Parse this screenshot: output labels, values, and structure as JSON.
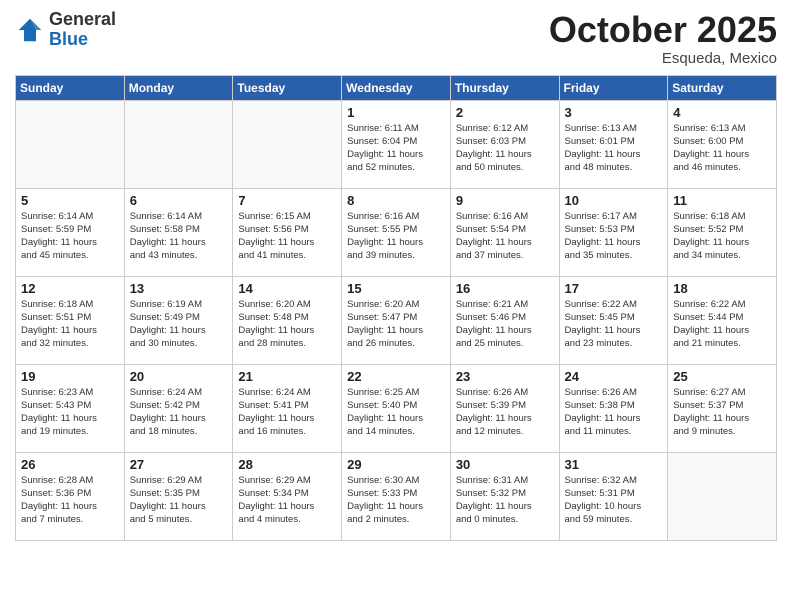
{
  "logo": {
    "general": "General",
    "blue": "Blue"
  },
  "title": "October 2025",
  "location": "Esqueda, Mexico",
  "days_header": [
    "Sunday",
    "Monday",
    "Tuesday",
    "Wednesday",
    "Thursday",
    "Friday",
    "Saturday"
  ],
  "weeks": [
    [
      {
        "day": "",
        "info": ""
      },
      {
        "day": "",
        "info": ""
      },
      {
        "day": "",
        "info": ""
      },
      {
        "day": "1",
        "info": "Sunrise: 6:11 AM\nSunset: 6:04 PM\nDaylight: 11 hours\nand 52 minutes."
      },
      {
        "day": "2",
        "info": "Sunrise: 6:12 AM\nSunset: 6:03 PM\nDaylight: 11 hours\nand 50 minutes."
      },
      {
        "day": "3",
        "info": "Sunrise: 6:13 AM\nSunset: 6:01 PM\nDaylight: 11 hours\nand 48 minutes."
      },
      {
        "day": "4",
        "info": "Sunrise: 6:13 AM\nSunset: 6:00 PM\nDaylight: 11 hours\nand 46 minutes."
      }
    ],
    [
      {
        "day": "5",
        "info": "Sunrise: 6:14 AM\nSunset: 5:59 PM\nDaylight: 11 hours\nand 45 minutes."
      },
      {
        "day": "6",
        "info": "Sunrise: 6:14 AM\nSunset: 5:58 PM\nDaylight: 11 hours\nand 43 minutes."
      },
      {
        "day": "7",
        "info": "Sunrise: 6:15 AM\nSunset: 5:56 PM\nDaylight: 11 hours\nand 41 minutes."
      },
      {
        "day": "8",
        "info": "Sunrise: 6:16 AM\nSunset: 5:55 PM\nDaylight: 11 hours\nand 39 minutes."
      },
      {
        "day": "9",
        "info": "Sunrise: 6:16 AM\nSunset: 5:54 PM\nDaylight: 11 hours\nand 37 minutes."
      },
      {
        "day": "10",
        "info": "Sunrise: 6:17 AM\nSunset: 5:53 PM\nDaylight: 11 hours\nand 35 minutes."
      },
      {
        "day": "11",
        "info": "Sunrise: 6:18 AM\nSunset: 5:52 PM\nDaylight: 11 hours\nand 34 minutes."
      }
    ],
    [
      {
        "day": "12",
        "info": "Sunrise: 6:18 AM\nSunset: 5:51 PM\nDaylight: 11 hours\nand 32 minutes."
      },
      {
        "day": "13",
        "info": "Sunrise: 6:19 AM\nSunset: 5:49 PM\nDaylight: 11 hours\nand 30 minutes."
      },
      {
        "day": "14",
        "info": "Sunrise: 6:20 AM\nSunset: 5:48 PM\nDaylight: 11 hours\nand 28 minutes."
      },
      {
        "day": "15",
        "info": "Sunrise: 6:20 AM\nSunset: 5:47 PM\nDaylight: 11 hours\nand 26 minutes."
      },
      {
        "day": "16",
        "info": "Sunrise: 6:21 AM\nSunset: 5:46 PM\nDaylight: 11 hours\nand 25 minutes."
      },
      {
        "day": "17",
        "info": "Sunrise: 6:22 AM\nSunset: 5:45 PM\nDaylight: 11 hours\nand 23 minutes."
      },
      {
        "day": "18",
        "info": "Sunrise: 6:22 AM\nSunset: 5:44 PM\nDaylight: 11 hours\nand 21 minutes."
      }
    ],
    [
      {
        "day": "19",
        "info": "Sunrise: 6:23 AM\nSunset: 5:43 PM\nDaylight: 11 hours\nand 19 minutes."
      },
      {
        "day": "20",
        "info": "Sunrise: 6:24 AM\nSunset: 5:42 PM\nDaylight: 11 hours\nand 18 minutes."
      },
      {
        "day": "21",
        "info": "Sunrise: 6:24 AM\nSunset: 5:41 PM\nDaylight: 11 hours\nand 16 minutes."
      },
      {
        "day": "22",
        "info": "Sunrise: 6:25 AM\nSunset: 5:40 PM\nDaylight: 11 hours\nand 14 minutes."
      },
      {
        "day": "23",
        "info": "Sunrise: 6:26 AM\nSunset: 5:39 PM\nDaylight: 11 hours\nand 12 minutes."
      },
      {
        "day": "24",
        "info": "Sunrise: 6:26 AM\nSunset: 5:38 PM\nDaylight: 11 hours\nand 11 minutes."
      },
      {
        "day": "25",
        "info": "Sunrise: 6:27 AM\nSunset: 5:37 PM\nDaylight: 11 hours\nand 9 minutes."
      }
    ],
    [
      {
        "day": "26",
        "info": "Sunrise: 6:28 AM\nSunset: 5:36 PM\nDaylight: 11 hours\nand 7 minutes."
      },
      {
        "day": "27",
        "info": "Sunrise: 6:29 AM\nSunset: 5:35 PM\nDaylight: 11 hours\nand 5 minutes."
      },
      {
        "day": "28",
        "info": "Sunrise: 6:29 AM\nSunset: 5:34 PM\nDaylight: 11 hours\nand 4 minutes."
      },
      {
        "day": "29",
        "info": "Sunrise: 6:30 AM\nSunset: 5:33 PM\nDaylight: 11 hours\nand 2 minutes."
      },
      {
        "day": "30",
        "info": "Sunrise: 6:31 AM\nSunset: 5:32 PM\nDaylight: 11 hours\nand 0 minutes."
      },
      {
        "day": "31",
        "info": "Sunrise: 6:32 AM\nSunset: 5:31 PM\nDaylight: 10 hours\nand 59 minutes."
      },
      {
        "day": "",
        "info": ""
      }
    ]
  ]
}
